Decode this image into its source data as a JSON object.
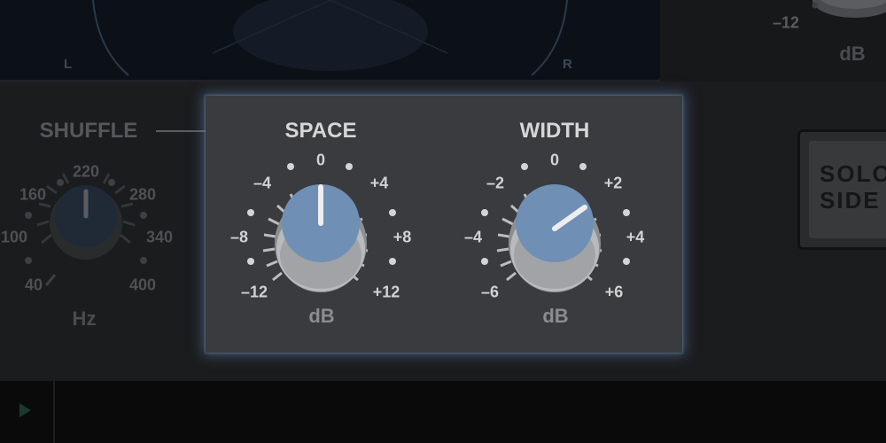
{
  "scope": {
    "left_label": "L",
    "right_label": "R"
  },
  "output": {
    "tick_label": "-12",
    "unit": "dB"
  },
  "shuffle": {
    "title": "SHUFFLE",
    "unit": "Hz",
    "scale": [
      "40",
      "100",
      "160",
      "220",
      "280",
      "340",
      "400"
    ],
    "value": "220"
  },
  "space": {
    "title": "SPACE",
    "unit": "dB",
    "scale": [
      "-12",
      "-8",
      "-4",
      "0",
      "+4",
      "+8",
      "+12"
    ],
    "value": "0"
  },
  "width": {
    "title": "WIDTH",
    "unit": "dB",
    "scale": [
      "-6",
      "-4",
      "-2",
      "0",
      "+2",
      "+4",
      "+6"
    ],
    "value": "+2"
  },
  "solo_side": {
    "line1": "SOLO",
    "line2": "SIDE"
  },
  "colors": {
    "knob_blue": "#6f8fb5",
    "highlight_glow": "#5f82aa",
    "panel": "#3a3b3e",
    "background": "#1b1c1e"
  },
  "icons": {
    "play": "play-icon"
  }
}
